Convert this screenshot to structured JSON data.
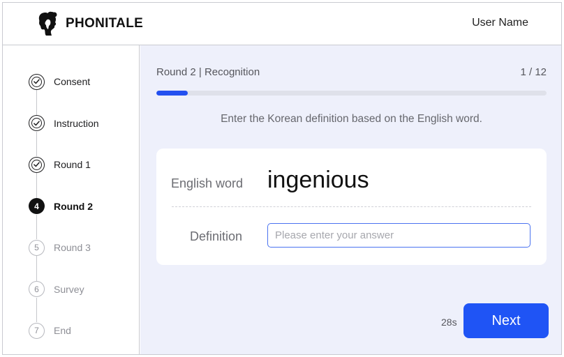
{
  "header": {
    "brand": "PHONITALE",
    "user_name": "User Name",
    "logo_icon": "woman-silhouette-icon"
  },
  "sidebar": {
    "steps": [
      {
        "label": "Consent",
        "status": "done",
        "marker": ""
      },
      {
        "label": "Instruction",
        "status": "done",
        "marker": ""
      },
      {
        "label": "Round 1",
        "status": "done",
        "marker": ""
      },
      {
        "label": "Round 2",
        "status": "active",
        "marker": "4"
      },
      {
        "label": "Round 3",
        "status": "todo",
        "marker": "5"
      },
      {
        "label": "Survey",
        "status": "todo",
        "marker": "6"
      },
      {
        "label": "End",
        "status": "todo",
        "marker": "7"
      }
    ]
  },
  "main": {
    "round_title": "Round 2 | Recognition",
    "counter": "1 / 12",
    "progress_fraction": 0.08,
    "instruction": "Enter the Korean definition based on the English word.",
    "word_label": "English word",
    "word": "ingenious",
    "definition_label": "Definition",
    "definition_value": "",
    "definition_placeholder": "Please enter your answer",
    "timer": "28s",
    "next_label": "Next"
  },
  "colors": {
    "accent": "#1f54f5",
    "main_background": "#eef0fb",
    "active_step": "#111111",
    "inactive_step": "#8e8f96"
  }
}
